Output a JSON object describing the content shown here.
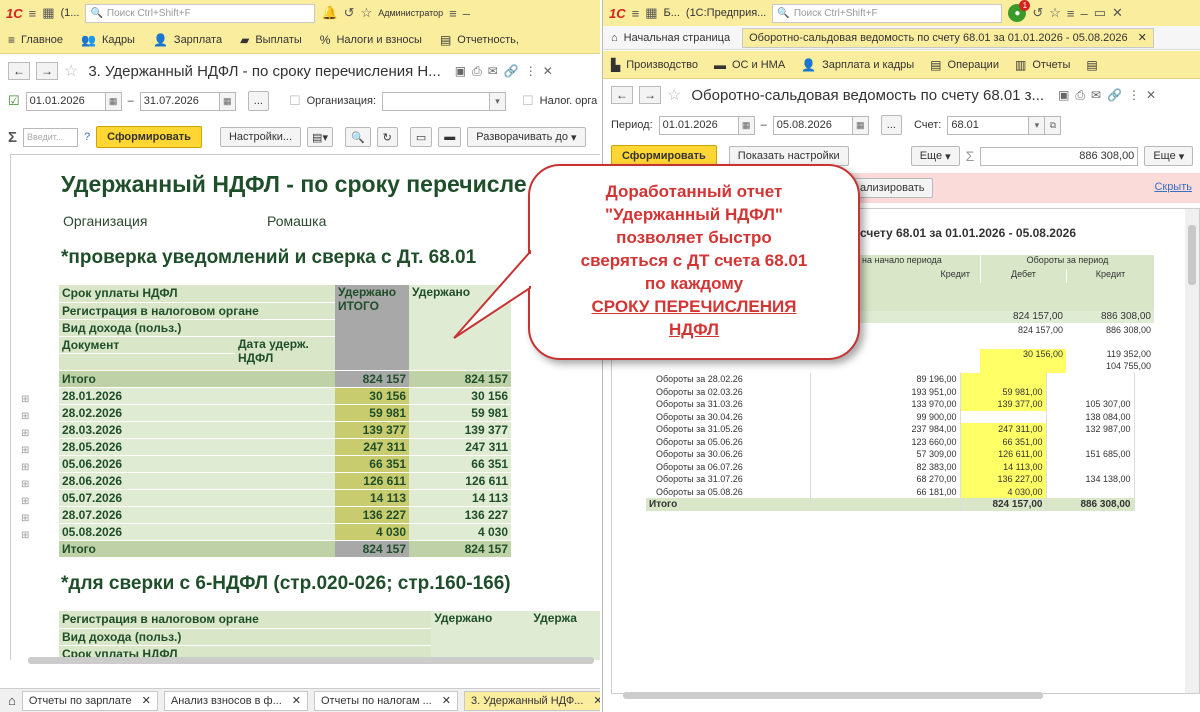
{
  "left": {
    "title_tab": "(1...",
    "search_placeholder": "Поиск Ctrl+Shift+F",
    "user": "Администратор",
    "menu": [
      "Главное",
      "Кадры",
      "Зарплата",
      "Выплаты",
      "Налоги и взносы",
      "Отчетность,"
    ],
    "form_title": "3. Удержанный НДФЛ - по сроку перечисления Н...",
    "date_from": "01.01.2026",
    "date_to": "31.07.2026",
    "ellipsis": "...",
    "org_label": "Организация:",
    "nalog_label": "Налог. орга",
    "search_small_placeholder": "Введит...",
    "help": "?",
    "generate": "Сформировать",
    "settings": "Настройки...",
    "expand": "Разворачивать до",
    "report": {
      "title": "Удержанный НДФЛ - по сроку перечисле",
      "org_label": "Организация",
      "org_value": "Ромашка",
      "section1": "*проверка уведомлений и сверка с Дт. 68.01",
      "section2": "*для сверки с 6-НДФЛ (стр.020-026; стр.160-166)",
      "headers": {
        "h1": "Срок уплаты НДФЛ",
        "h2": "Регистрация в налоговом органе",
        "h3": "Вид дохода (польз.)",
        "h4": "Документ",
        "h5": "Дата удерж. НДФЛ",
        "col_a": "Удержано ИТОГО",
        "col_b": "Удержано"
      },
      "total_label": "Итого",
      "total_a": "824 157",
      "total_b": "824 157",
      "rows": [
        {
          "date": "28.01.2026",
          "a": "30 156",
          "b": "30 156"
        },
        {
          "date": "28.02.2026",
          "a": "59 981",
          "b": "59 981"
        },
        {
          "date": "28.03.2026",
          "a": "139 377",
          "b": "139 377"
        },
        {
          "date": "28.05.2026",
          "a": "247 311",
          "b": "247 311"
        },
        {
          "date": "05.06.2026",
          "a": "66 351",
          "b": "66 351"
        },
        {
          "date": "28.06.2026",
          "a": "126 611",
          "b": "126 611"
        },
        {
          "date": "05.07.2026",
          "a": "14 113",
          "b": "14 113"
        },
        {
          "date": "28.07.2026",
          "a": "136 227",
          "b": "136 227"
        },
        {
          "date": "05.08.2026",
          "a": "4 030",
          "b": "4 030"
        }
      ],
      "t2": {
        "h1": "Регистрация в налоговом органе",
        "h2": "Вид дохода (польз.)",
        "h3": "Срок уплаты НДФЛ",
        "c1": "Удержано",
        "c2": "Удержа"
      }
    },
    "bottom_tabs": [
      "Отчеты по зарплате",
      "Анализ взносов в ф...",
      "Отчеты по налогам ...",
      "3. Удержанный НДФ..."
    ]
  },
  "right": {
    "title_tab": "Б...",
    "title_app": "(1С:Предприя...",
    "search_placeholder": "Поиск Ctrl+Shift+F",
    "badge": "1",
    "home_tab": "Начальная страница",
    "doc_tab": "Оборотно-сальдовая ведомость по счету 68.01 за 01.01.2026 - 05.08.2026",
    "menu": [
      "Производство",
      "ОС и НМА",
      "Зарплата и кадры",
      "Операции",
      "Отчеты"
    ],
    "form_title": "Оборотно-сальдовая ведомость по счету 68.01 з...",
    "period_label": "Период:",
    "date_from": "01.01.2026",
    "date_to": "05.08.2026",
    "ellipsis": "...",
    "account_label": "Счет:",
    "account": "68.01",
    "generate": "Сформировать",
    "show_settings": "Показать настройки",
    "more": "Еще",
    "sum_value": "886 308,00",
    "analyze": "ализировать",
    "hide": "Скрыть",
    "report_title": "счету 68.01 за 01.01.2026 - 05.08.2026",
    "h_start": "на начало периода",
    "h_turn": "Обороты за период",
    "h_credit": "Кредит",
    "h_debit": "Дебет",
    "h_credit2": "Кредит",
    "top_debit": "824 157,00",
    "top_credit": "886 308,00",
    "sub_debit": "824 157,00",
    "sub_credit": "886 308,00",
    "first_debit": "30 156,00",
    "first_credit": "119 352,00",
    "second_credit": "104 755,00",
    "rows": [
      {
        "name": "Обороты за 28.02.26",
        "start": "89 196,00",
        "debit": "",
        "credit": ""
      },
      {
        "name": "Обороты за 02.03.26",
        "start": "193 951,00",
        "debit": "59 981,00",
        "credit": ""
      },
      {
        "name": "Обороты за 31.03.26",
        "start": "133 970,00",
        "debit": "139 377,00",
        "credit": "105 307,00"
      },
      {
        "name": "Обороты за 30.04.26",
        "start": "99 900,00",
        "debit": "",
        "credit": "138 084,00"
      },
      {
        "name": "Обороты за 31.05.26",
        "start": "237 984,00",
        "debit": "247 311,00",
        "credit": "132 987,00"
      },
      {
        "name": "Обороты за 05.06.26",
        "start": "123 660,00",
        "debit": "66 351,00",
        "credit": ""
      },
      {
        "name": "Обороты за 30.06.26",
        "start": "57 309,00",
        "debit": "126 611,00",
        "credit": "151 685,00"
      },
      {
        "name": "Обороты за 06.07.26",
        "start": "82 383,00",
        "debit": "14 113,00",
        "credit": ""
      },
      {
        "name": "Обороты за 31.07.26",
        "start": "68 270,00",
        "debit": "136 227,00",
        "credit": "134 138,00"
      },
      {
        "name": "Обороты за 05.08.26",
        "start": "66 181,00",
        "debit": "4 030,00",
        "credit": ""
      }
    ],
    "total_label": "Итого",
    "total_debit": "824 157,00",
    "total_credit": "886 308,00"
  },
  "callout": {
    "l1": "Доработанный отчет",
    "l2": "\"Удержанный НДФЛ\"",
    "l3": "позволяет быстро",
    "l4": "сверяться с ДТ счета 68.01",
    "l5": "по каждому",
    "l6": "СРОКУ ПЕРЕЧИСЛЕНИЯ",
    "l7": "НДФЛ"
  },
  "colors": {
    "accent_yellow": "#fbed9e",
    "brand_red": "#d4221e",
    "report_green": "#1f4e2a",
    "callout_red": "#d33434"
  }
}
